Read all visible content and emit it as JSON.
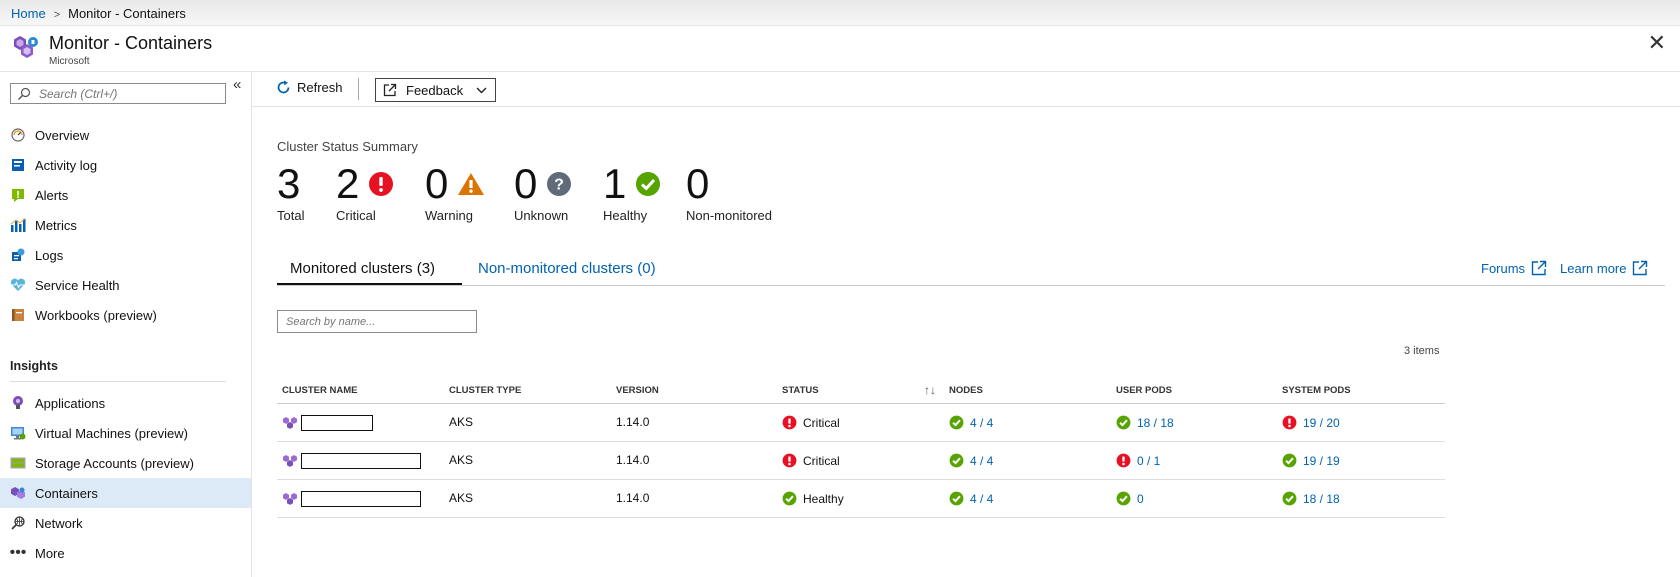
{
  "breadcrumb": {
    "home": "Home",
    "current": "Monitor - Containers"
  },
  "header": {
    "title": "Monitor - Containers",
    "subtitle": "Microsoft"
  },
  "sidebar": {
    "search_placeholder": "Search (Ctrl+/)",
    "items": [
      {
        "label": "Overview",
        "icon": "gauge-icon"
      },
      {
        "label": "Activity log",
        "icon": "activity-log-icon"
      },
      {
        "label": "Alerts",
        "icon": "alert-icon"
      },
      {
        "label": "Metrics",
        "icon": "metrics-icon"
      },
      {
        "label": "Logs",
        "icon": "logs-icon"
      },
      {
        "label": "Service Health",
        "icon": "heart-icon"
      },
      {
        "label": "Workbooks (preview)",
        "icon": "workbook-icon"
      }
    ],
    "section_label": "Insights",
    "insight_items": [
      {
        "label": "Applications",
        "icon": "bulb-icon"
      },
      {
        "label": "Virtual Machines (preview)",
        "icon": "vm-icon"
      },
      {
        "label": "Storage Accounts (preview)",
        "icon": "storage-icon"
      },
      {
        "label": "Containers",
        "icon": "containers-icon",
        "active": true
      },
      {
        "label": "Network",
        "icon": "network-icon"
      },
      {
        "label": "More",
        "icon": "more-icon"
      }
    ]
  },
  "toolbar": {
    "refresh_label": "Refresh",
    "feedback_label": "Feedback"
  },
  "summary": {
    "title": "Cluster Status Summary",
    "stats": [
      {
        "value": "3",
        "label": "Total"
      },
      {
        "value": "2",
        "label": "Critical"
      },
      {
        "value": "0",
        "label": "Warning"
      },
      {
        "value": "0",
        "label": "Unknown"
      },
      {
        "value": "1",
        "label": "Healthy"
      },
      {
        "value": "0",
        "label": "Non-monitored"
      }
    ]
  },
  "tabs": {
    "monitored": "Monitored clusters (3)",
    "non_monitored": "Non-monitored clusters (0)"
  },
  "links": {
    "forums": "Forums",
    "learn_more": "Learn more"
  },
  "filter": {
    "placeholder": "Search by name..."
  },
  "grid": {
    "count_text": "3 items",
    "columns": [
      "CLUSTER NAME",
      "CLUSTER TYPE",
      "VERSION",
      "STATUS",
      "NODES",
      "USER PODS",
      "SYSTEM PODS"
    ],
    "rows": [
      {
        "type": "AKS",
        "version": "1.14.0",
        "status": "Critical",
        "nodes": "4 / 4",
        "user_pods": "18 / 18",
        "system_pods": "19 / 20"
      },
      {
        "type": "AKS",
        "version": "1.14.0",
        "status": "Critical",
        "nodes": "4 / 4",
        "user_pods": "0 / 1",
        "system_pods": "19 / 19"
      },
      {
        "type": "AKS",
        "version": "1.14.0",
        "status": "Healthy",
        "nodes": "4 / 4",
        "user_pods": "0",
        "system_pods": "18 / 18"
      }
    ]
  },
  "colors": {
    "critical": "#e81123",
    "warning": "#db7500",
    "unknown": "#5f6b78",
    "healthy": "#57a300",
    "link": "#0063b1",
    "active_nav": "#dce9f7"
  }
}
